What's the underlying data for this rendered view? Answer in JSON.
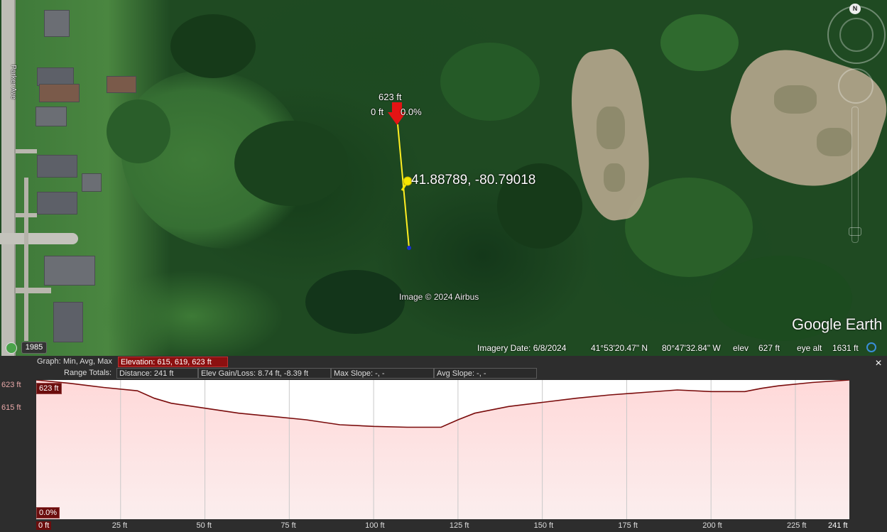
{
  "map": {
    "point_label_elev": "623 ft",
    "point_label_dist": "0 ft",
    "point_label_slope": "0.0%",
    "coordinates_label": "41.88789, -80.79018",
    "image_credit": "Image © 2024 Airbus",
    "logo_text": "Google Earth",
    "road_name": "Parker Ave",
    "year_badge": "1985",
    "north_label": "N",
    "status": {
      "imagery_date": "Imagery Date: 6/8/2024",
      "lat": "41°53'20.47\" N",
      "lon": "80°47'32.84\" W",
      "elev_label": "elev",
      "elev_value": "627 ft",
      "eye_alt_label": "eye alt",
      "eye_alt_value": "1631 ft"
    }
  },
  "profile": {
    "graph_label": "Graph:",
    "graph_mode": "Min, Avg, Max",
    "elevation_stat": "Elevation: 615, 619, 623 ft",
    "range_totals_label": "Range Totals:",
    "distance_stat": "Distance: 241 ft",
    "gain_loss_stat": "Elev Gain/Loss: 8.74 ft, -8.39 ft",
    "max_slope_stat": "Max Slope: -, -",
    "avg_slope_stat": "Avg Slope: -, -",
    "y_axis_top": "623 ft",
    "y_axis_bottom": "615 ft",
    "top_left_badge": "623 ft",
    "bottom_left_badge": "0.0%",
    "x_first": "0 ft",
    "close_symbol": "×"
  },
  "chart_data": {
    "type": "area",
    "x": [
      0,
      10,
      20,
      30,
      35,
      40,
      50,
      60,
      70,
      80,
      90,
      100,
      110,
      120,
      125,
      130,
      140,
      150,
      160,
      170,
      180,
      190,
      200,
      210,
      215,
      220,
      230,
      241
    ],
    "y": [
      623,
      622.6,
      622.1,
      621.7,
      620.8,
      620.2,
      619.6,
      619.0,
      618.6,
      618.2,
      617.6,
      617.4,
      617.3,
      617.3,
      618.2,
      619.0,
      619.8,
      620.3,
      620.8,
      621.2,
      621.5,
      621.8,
      621.6,
      621.6,
      622.0,
      622.3,
      622.7,
      623
    ],
    "tick_labels": [
      "0 ft",
      "25 ft",
      "50 ft",
      "75 ft",
      "100 ft",
      "125 ft",
      "150 ft",
      "175 ft",
      "200 ft",
      "225 ft",
      "241 ft"
    ],
    "tick_values": [
      0,
      25,
      50,
      75,
      100,
      125,
      150,
      175,
      200,
      225,
      241
    ],
    "xlim": [
      0,
      241
    ],
    "ylim": [
      606.2,
      623
    ],
    "y_ticks": [
      623,
      615
    ],
    "grid": true,
    "colors": {
      "line": "#7a0c0c",
      "fill_top": "#ffd9d9",
      "fill_bottom": "#fbeeee",
      "grid": "#c9c9c9"
    }
  }
}
